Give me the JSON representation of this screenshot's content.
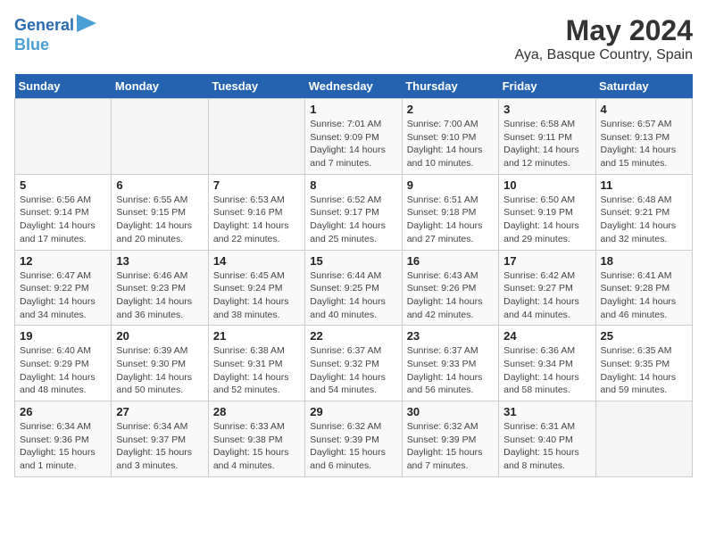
{
  "logo": {
    "line1": "General",
    "line2": "Blue"
  },
  "title": "May 2024",
  "subtitle": "Aya, Basque Country, Spain",
  "days_of_week": [
    "Sunday",
    "Monday",
    "Tuesday",
    "Wednesday",
    "Thursday",
    "Friday",
    "Saturday"
  ],
  "weeks": [
    [
      {
        "day": "",
        "info": ""
      },
      {
        "day": "",
        "info": ""
      },
      {
        "day": "",
        "info": ""
      },
      {
        "day": "1",
        "info": "Sunrise: 7:01 AM\nSunset: 9:09 PM\nDaylight: 14 hours\nand 7 minutes."
      },
      {
        "day": "2",
        "info": "Sunrise: 7:00 AM\nSunset: 9:10 PM\nDaylight: 14 hours\nand 10 minutes."
      },
      {
        "day": "3",
        "info": "Sunrise: 6:58 AM\nSunset: 9:11 PM\nDaylight: 14 hours\nand 12 minutes."
      },
      {
        "day": "4",
        "info": "Sunrise: 6:57 AM\nSunset: 9:13 PM\nDaylight: 14 hours\nand 15 minutes."
      }
    ],
    [
      {
        "day": "5",
        "info": "Sunrise: 6:56 AM\nSunset: 9:14 PM\nDaylight: 14 hours\nand 17 minutes."
      },
      {
        "day": "6",
        "info": "Sunrise: 6:55 AM\nSunset: 9:15 PM\nDaylight: 14 hours\nand 20 minutes."
      },
      {
        "day": "7",
        "info": "Sunrise: 6:53 AM\nSunset: 9:16 PM\nDaylight: 14 hours\nand 22 minutes."
      },
      {
        "day": "8",
        "info": "Sunrise: 6:52 AM\nSunset: 9:17 PM\nDaylight: 14 hours\nand 25 minutes."
      },
      {
        "day": "9",
        "info": "Sunrise: 6:51 AM\nSunset: 9:18 PM\nDaylight: 14 hours\nand 27 minutes."
      },
      {
        "day": "10",
        "info": "Sunrise: 6:50 AM\nSunset: 9:19 PM\nDaylight: 14 hours\nand 29 minutes."
      },
      {
        "day": "11",
        "info": "Sunrise: 6:48 AM\nSunset: 9:21 PM\nDaylight: 14 hours\nand 32 minutes."
      }
    ],
    [
      {
        "day": "12",
        "info": "Sunrise: 6:47 AM\nSunset: 9:22 PM\nDaylight: 14 hours\nand 34 minutes."
      },
      {
        "day": "13",
        "info": "Sunrise: 6:46 AM\nSunset: 9:23 PM\nDaylight: 14 hours\nand 36 minutes."
      },
      {
        "day": "14",
        "info": "Sunrise: 6:45 AM\nSunset: 9:24 PM\nDaylight: 14 hours\nand 38 minutes."
      },
      {
        "day": "15",
        "info": "Sunrise: 6:44 AM\nSunset: 9:25 PM\nDaylight: 14 hours\nand 40 minutes."
      },
      {
        "day": "16",
        "info": "Sunrise: 6:43 AM\nSunset: 9:26 PM\nDaylight: 14 hours\nand 42 minutes."
      },
      {
        "day": "17",
        "info": "Sunrise: 6:42 AM\nSunset: 9:27 PM\nDaylight: 14 hours\nand 44 minutes."
      },
      {
        "day": "18",
        "info": "Sunrise: 6:41 AM\nSunset: 9:28 PM\nDaylight: 14 hours\nand 46 minutes."
      }
    ],
    [
      {
        "day": "19",
        "info": "Sunrise: 6:40 AM\nSunset: 9:29 PM\nDaylight: 14 hours\nand 48 minutes."
      },
      {
        "day": "20",
        "info": "Sunrise: 6:39 AM\nSunset: 9:30 PM\nDaylight: 14 hours\nand 50 minutes."
      },
      {
        "day": "21",
        "info": "Sunrise: 6:38 AM\nSunset: 9:31 PM\nDaylight: 14 hours\nand 52 minutes."
      },
      {
        "day": "22",
        "info": "Sunrise: 6:37 AM\nSunset: 9:32 PM\nDaylight: 14 hours\nand 54 minutes."
      },
      {
        "day": "23",
        "info": "Sunrise: 6:37 AM\nSunset: 9:33 PM\nDaylight: 14 hours\nand 56 minutes."
      },
      {
        "day": "24",
        "info": "Sunrise: 6:36 AM\nSunset: 9:34 PM\nDaylight: 14 hours\nand 58 minutes."
      },
      {
        "day": "25",
        "info": "Sunrise: 6:35 AM\nSunset: 9:35 PM\nDaylight: 14 hours\nand 59 minutes."
      }
    ],
    [
      {
        "day": "26",
        "info": "Sunrise: 6:34 AM\nSunset: 9:36 PM\nDaylight: 15 hours\nand 1 minute."
      },
      {
        "day": "27",
        "info": "Sunrise: 6:34 AM\nSunset: 9:37 PM\nDaylight: 15 hours\nand 3 minutes."
      },
      {
        "day": "28",
        "info": "Sunrise: 6:33 AM\nSunset: 9:38 PM\nDaylight: 15 hours\nand 4 minutes."
      },
      {
        "day": "29",
        "info": "Sunrise: 6:32 AM\nSunset: 9:39 PM\nDaylight: 15 hours\nand 6 minutes."
      },
      {
        "day": "30",
        "info": "Sunrise: 6:32 AM\nSunset: 9:39 PM\nDaylight: 15 hours\nand 7 minutes."
      },
      {
        "day": "31",
        "info": "Sunrise: 6:31 AM\nSunset: 9:40 PM\nDaylight: 15 hours\nand 8 minutes."
      },
      {
        "day": "",
        "info": ""
      }
    ]
  ]
}
